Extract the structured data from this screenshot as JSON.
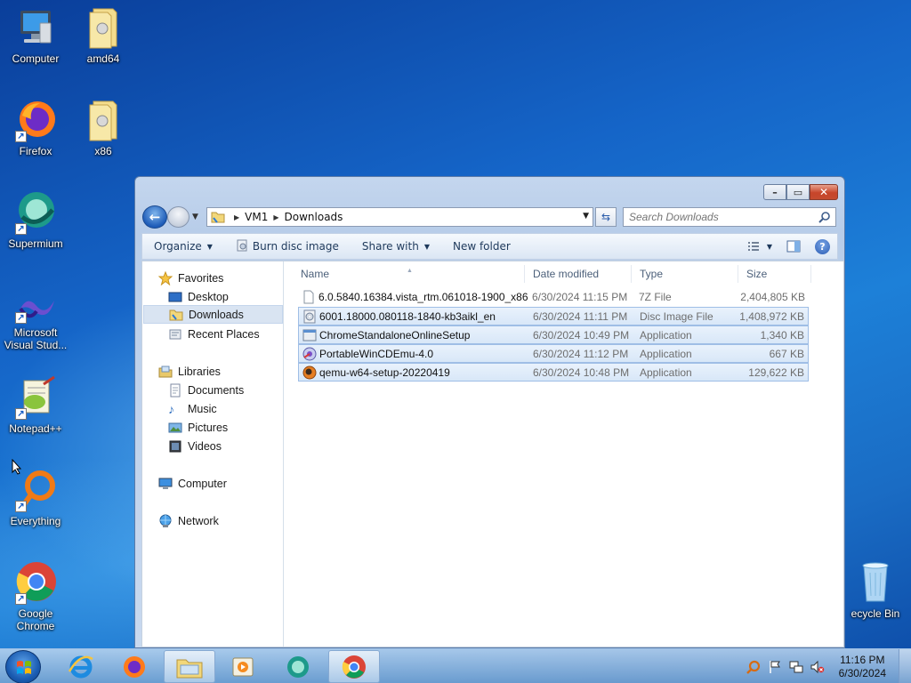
{
  "desktop": {
    "icons": [
      {
        "label": "Computer"
      },
      {
        "label": "amd64"
      },
      {
        "label": "Firefox"
      },
      {
        "label": "x86"
      },
      {
        "label": "Supermium"
      },
      {
        "label": "Microsoft Visual Stud..."
      },
      {
        "label": "Notepad++"
      },
      {
        "label": "Everything"
      },
      {
        "label": "Google Chrome"
      },
      {
        "label": "ecycle Bin"
      }
    ]
  },
  "window": {
    "address": {
      "root": "VM1",
      "current": "Downloads"
    },
    "search_placeholder": "Search Downloads",
    "toolbar": {
      "organize": "Organize",
      "burn": "Burn disc image",
      "share": "Share with",
      "new_folder": "New folder"
    },
    "nav": {
      "favorites": "Favorites",
      "desktop": "Desktop",
      "downloads": "Downloads",
      "recent": "Recent Places",
      "libraries": "Libraries",
      "documents": "Documents",
      "music": "Music",
      "pictures": "Pictures",
      "videos": "Videos",
      "computer": "Computer",
      "network": "Network"
    },
    "columns": {
      "name": "Name",
      "date": "Date modified",
      "type": "Type",
      "size": "Size"
    },
    "files": [
      {
        "name": "6.0.5840.16384.vista_rtm.061018-1900_x86...",
        "date": "6/30/2024 11:15 PM",
        "type": "7Z File",
        "size": "2,404,805 KB",
        "icon": "blank-file-icon",
        "selected": false
      },
      {
        "name": "6001.18000.080118-1840-kb3aikl_en",
        "date": "6/30/2024 11:11 PM",
        "type": "Disc Image File",
        "size": "1,408,972 KB",
        "icon": "disc-image-icon",
        "selected": true
      },
      {
        "name": "ChromeStandaloneOnlineSetup",
        "date": "6/30/2024 10:49 PM",
        "type": "Application",
        "size": "1,340 KB",
        "icon": "app-icon",
        "selected": true
      },
      {
        "name": "PortableWinCDEmu-4.0",
        "date": "6/30/2024 11:12 PM",
        "type": "Application",
        "size": "667 KB",
        "icon": "wincdemu-icon",
        "selected": true
      },
      {
        "name": "qemu-w64-setup-20220419",
        "date": "6/30/2024 10:48 PM",
        "type": "Application",
        "size": "129,622 KB",
        "icon": "qemu-icon",
        "selected": true
      }
    ]
  },
  "taskbar": {
    "clock_time": "11:16 PM",
    "clock_date": "6/30/2024"
  },
  "colors": {
    "desktop_blue": "#1565c8",
    "selection_fill": "#d8e7f8",
    "selection_border": "#9fbee6",
    "close_red": "#c7452a"
  }
}
